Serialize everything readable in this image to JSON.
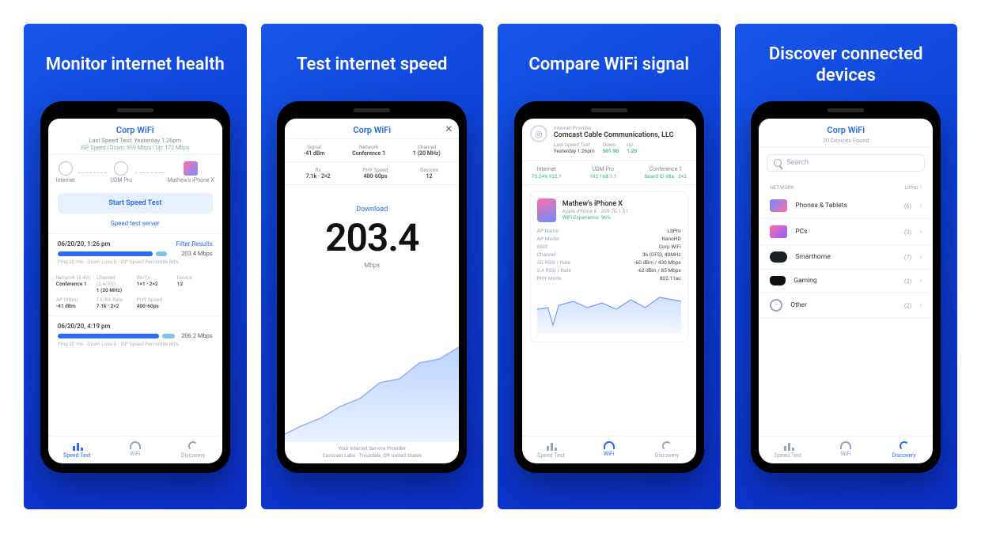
{
  "panels": [
    {
      "title": "Monitor internet health"
    },
    {
      "title": "Test internet speed"
    },
    {
      "title": "Compare WiFi signal"
    },
    {
      "title": "Discover connected devices"
    }
  ],
  "wifi_name": "Corp WiFi",
  "p1": {
    "last_test_label": "Last Speed Test: Yesterday 1:26pm",
    "summary": "ISP Speed  |  Down: 959 Mbps  |  Up: 172 Mbps",
    "nodes": {
      "internet": "Internet",
      "udm": "UDM Pro",
      "device": "Mathew's iPhone X"
    },
    "start_button": "Start Speed Test",
    "choose_server": "Speed test server",
    "results": [
      {
        "timestamp": "06/20/20, 1:26 pm",
        "filter": "Filter Results",
        "dl_width": 120,
        "ul_width": 14,
        "value": "203.4 Mbps",
        "meta": "Ping 20 ms · Down Loss 0 · ISP Speed Percentile 80%"
      },
      {
        "timestamp": "06/20/20, 4:19 pm",
        "filter": "",
        "dl_width": 128,
        "ul_width": 16,
        "value": "206.2 Mbps",
        "meta": "Ping 20 ms · Down Loss 0 · ISP Speed Percentile 80%"
      }
    ],
    "stats": [
      {
        "lab": "Network (2.4G)",
        "v": "Conference 1"
      },
      {
        "lab": "Channel (2.4/5G)",
        "v": "1 (20 MHz)"
      },
      {
        "lab": "Rx/Tx",
        "v": "1×1 · 2×2"
      },
      {
        "lab": "Device",
        "v": "12"
      },
      {
        "lab": "AP (dBm)",
        "v": "-41 dBm"
      },
      {
        "lab": "TX/RX Rate",
        "v": "7.1k · 2×2"
      },
      {
        "lab": "PHY Speed",
        "v": "400-60ps"
      },
      {
        "lab": "",
        "v": ""
      }
    ],
    "tabs": {
      "speed": "Speed Test",
      "wifi": "WiFi",
      "discovery": "Discovery"
    }
  },
  "p2": {
    "metrics": [
      {
        "lab": "Signal",
        "v": "-41 dBm"
      },
      {
        "lab": "Network",
        "v": "Conference 1"
      },
      {
        "lab": "Channel",
        "v": "1 (20 MHz)"
      },
      {
        "lab": "Rx",
        "v": "7.1k · 2×2"
      },
      {
        "lab": "PHY Speed",
        "v": "400-60ps"
      },
      {
        "lab": "Devices",
        "v": "12"
      }
    ],
    "download_label": "Download",
    "big_value": "203.4",
    "unit": "Mbps",
    "isp_note_1": "Your Internet Service Provider",
    "isp_note_2": "Comcast Labs · Troutdale, OR United States"
  },
  "p3": {
    "isp_tag": "Internet Provider",
    "isp_name": "Comcast Cable Communications, LLC",
    "isp_last": "Last Speed Test",
    "isp_when": "Yesterday 1:26pm",
    "isp_down_lab": "Down",
    "isp_down": "501.90",
    "isp_up_lab": "Up",
    "isp_up": "1.20",
    "ips": [
      {
        "lab": "Internet",
        "v": "73.249.102.1"
      },
      {
        "lab": "UDM Pro",
        "v": "192.168.1.1"
      },
      {
        "lab": "Conference 1",
        "v": "Board ID 98a · 2×2"
      }
    ],
    "device": {
      "name": "Mathew's iPhone X",
      "sub": "Apple iPhone X · 209.70.1.51",
      "exp": "WiFi Experience: 96%"
    },
    "kv": [
      {
        "k": "AP Name",
        "v": "LitPro"
      },
      {
        "k": "AP Model",
        "v": "NanoHD"
      },
      {
        "k": "SSID",
        "v": "Corp WiFi"
      },
      {
        "k": "Channel",
        "v": "36 (DFS), 40MHz"
      },
      {
        "k": "5G RSSI / Rate",
        "v": "-60 dBm / 430 Mbps"
      },
      {
        "k": "2.4 RSSI / Rate",
        "v": "-62 dBm / 85 Mbps"
      },
      {
        "k": "PHY Mode",
        "v": "802.11ac"
      }
    ],
    "tabs": {
      "speed": "Speed Test",
      "wifi": "WiFi",
      "discovery": "Discovery"
    }
  },
  "p4": {
    "found": "30 Devices Found",
    "search_placeholder": "Search",
    "section_label": "NETWORK",
    "section_value": "LitPro",
    "rows": [
      {
        "icon": "phones",
        "name": "Phones & Tablets",
        "count": "(6)"
      },
      {
        "icon": "pcs",
        "name": "PCs",
        "count": "(3)"
      },
      {
        "icon": "smart",
        "name": "Smarthome",
        "count": "(7)"
      },
      {
        "icon": "game",
        "name": "Gaming",
        "count": "(2)"
      },
      {
        "icon": "other",
        "name": "Other",
        "count": "(2)"
      }
    ],
    "tabs": {
      "speed": "Speed Test",
      "wifi": "WiFi",
      "discovery": "Discovery"
    }
  }
}
